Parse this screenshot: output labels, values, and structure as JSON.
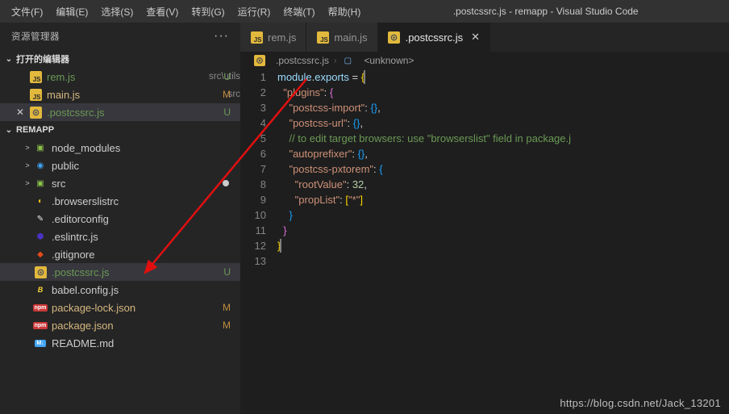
{
  "menu": {
    "items": [
      "文件(F)",
      "编辑(E)",
      "选择(S)",
      "查看(V)",
      "转到(G)",
      "运行(R)",
      "终端(T)",
      "帮助(H)"
    ]
  },
  "window_title": ".postcssrc.js - remapp - Visual Studio Code",
  "explorer": {
    "title": "资源管理器",
    "open_editors": "打开的编辑器",
    "project": "REMAPP",
    "items_open": [
      {
        "icon": "js",
        "name": "rem.js",
        "sub": "src\\utils",
        "badge": "U",
        "cls": "modU"
      },
      {
        "icon": "js",
        "name": "main.js",
        "sub": "src",
        "badge": "M",
        "cls": "modM"
      },
      {
        "icon": "gearjs",
        "name": ".postcssrc.js",
        "badge": "U",
        "cls": "modU",
        "close": true,
        "sel": true
      }
    ],
    "tree": [
      {
        "t": "folder",
        "icon": "pkg",
        "name": "node_modules",
        "chev": ">"
      },
      {
        "t": "folder",
        "icon": "pub",
        "name": "public",
        "chev": ">"
      },
      {
        "t": "folder",
        "icon": "src",
        "name": "src",
        "chev": ">",
        "dot": true
      },
      {
        "t": "file",
        "icon": "browserslist",
        "name": ".browserslistrc"
      },
      {
        "t": "file",
        "icon": "editorconfig",
        "name": ".editorconfig"
      },
      {
        "t": "file",
        "icon": "eslint",
        "name": ".eslintrc.js"
      },
      {
        "t": "file",
        "icon": "git",
        "name": ".gitignore"
      },
      {
        "t": "file",
        "icon": "gearjs",
        "name": ".postcssrc.js",
        "badge": "U",
        "cls": "modU",
        "sel": true
      },
      {
        "t": "file",
        "icon": "babel",
        "name": "babel.config.js"
      },
      {
        "t": "file",
        "icon": "npm",
        "name": "package-lock.json",
        "badge": "M",
        "cls": "modM"
      },
      {
        "t": "file",
        "icon": "npm",
        "name": "package.json",
        "badge": "M",
        "cls": "modM"
      },
      {
        "t": "file",
        "icon": "md",
        "name": "README.md"
      }
    ]
  },
  "tabs": [
    {
      "icon": "js",
      "label": "rem.js"
    },
    {
      "icon": "js",
      "label": "main.js"
    },
    {
      "icon": "gearjs",
      "label": ".postcssrc.js",
      "active": true,
      "close": true
    }
  ],
  "breadcrumb": {
    "file": ".postcssrc.js",
    "symbol": "<unknown>"
  },
  "code": {
    "lines": [
      1,
      2,
      3,
      4,
      5,
      6,
      7,
      8,
      9,
      10,
      11,
      12,
      13
    ],
    "text": [
      [
        {
          "c": "prop",
          "t": "module"
        },
        {
          "c": "pun",
          "t": "."
        },
        {
          "c": "prop",
          "t": "exports"
        },
        {
          "c": "pun",
          "t": " = "
        },
        {
          "c": "brk",
          "t": "{"
        },
        {
          "c": "curbox",
          "t": ""
        }
      ],
      [
        {
          "c": "pun",
          "t": "  "
        },
        {
          "c": "str",
          "t": "\"plugins\""
        },
        {
          "c": "pun",
          "t": ": "
        },
        {
          "c": "brk2",
          "t": "{"
        }
      ],
      [
        {
          "c": "pun",
          "t": "    "
        },
        {
          "c": "str",
          "t": "\"postcss-import\""
        },
        {
          "c": "pun",
          "t": ": "
        },
        {
          "c": "brk3",
          "t": "{}"
        },
        {
          "c": "pun",
          "t": ","
        }
      ],
      [
        {
          "c": "pun",
          "t": "    "
        },
        {
          "c": "str",
          "t": "\"postcss-url\""
        },
        {
          "c": "pun",
          "t": ": "
        },
        {
          "c": "brk3",
          "t": "{}"
        },
        {
          "c": "pun",
          "t": ","
        }
      ],
      [
        {
          "c": "pun",
          "t": "    "
        },
        {
          "c": "cmt",
          "t": "// to edit target browsers: use \"browserslist\" field in package.j"
        }
      ],
      [
        {
          "c": "pun",
          "t": "    "
        },
        {
          "c": "str",
          "t": "\"autoprefixer\""
        },
        {
          "c": "pun",
          "t": ": "
        },
        {
          "c": "brk3",
          "t": "{}"
        },
        {
          "c": "pun",
          "t": ","
        }
      ],
      [
        {
          "c": "pun",
          "t": "    "
        },
        {
          "c": "str",
          "t": "\"postcss-pxtorem\""
        },
        {
          "c": "pun",
          "t": ": "
        },
        {
          "c": "brk3",
          "t": "{"
        }
      ],
      [
        {
          "c": "pun",
          "t": "      "
        },
        {
          "c": "str",
          "t": "\"rootValue\""
        },
        {
          "c": "pun",
          "t": ": "
        },
        {
          "c": "num",
          "t": "32"
        },
        {
          "c": "pun",
          "t": ","
        }
      ],
      [
        {
          "c": "pun",
          "t": "      "
        },
        {
          "c": "str",
          "t": "\"propList\""
        },
        {
          "c": "pun",
          "t": ": "
        },
        {
          "c": "brk",
          "t": "["
        },
        {
          "c": "str",
          "t": "\"*\""
        },
        {
          "c": "brk",
          "t": "]"
        }
      ],
      [
        {
          "c": "pun",
          "t": "    "
        },
        {
          "c": "brk3",
          "t": "}"
        }
      ],
      [
        {
          "c": "pun",
          "t": "  "
        },
        {
          "c": "brk2",
          "t": "}"
        }
      ],
      [
        {
          "c": "brk",
          "t": "}"
        },
        {
          "c": "curbox",
          "t": ""
        }
      ],
      [
        {
          "c": "pun",
          "t": ""
        }
      ]
    ]
  },
  "watermark": "https://blog.csdn.net/Jack_13201"
}
